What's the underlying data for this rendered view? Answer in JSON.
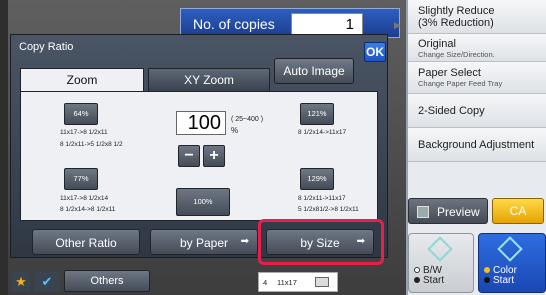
{
  "copies": {
    "label": "No. of copies",
    "value": "1"
  },
  "right_panel": {
    "items": [
      {
        "title": "Slightly Reduce",
        "title2": "(3% Reduction)",
        "sub": ""
      },
      {
        "title": "Original",
        "sub": "Change Size/Direction."
      },
      {
        "title": "Paper Select",
        "sub": "Change Paper Feed Tray"
      },
      {
        "title": "2-Sided Copy",
        "sub": ""
      },
      {
        "title": "Background Adjustment",
        "sub": ""
      }
    ],
    "preview_label": "Preview",
    "ca_label": "CA",
    "bw_start": [
      "B/W",
      "Start"
    ],
    "color_start": [
      "Color",
      "Start"
    ]
  },
  "dialog": {
    "title": "Copy Ratio",
    "ok_label": "OK",
    "tabs": [
      {
        "label": "Zoom",
        "active": true
      },
      {
        "label": "XY Zoom",
        "active": false
      }
    ],
    "auto_image_label": "Auto Image",
    "ratio": {
      "value": "100",
      "range": "( 25~400 )",
      "unit": "%"
    },
    "presets": [
      {
        "label": "64%",
        "notes": [
          "11x17->8 1/2x11",
          "8 1/2x11->5 1/2x8 1/2"
        ]
      },
      {
        "label": "121%",
        "notes": [
          "8 1/2x14->11x17"
        ]
      },
      {
        "label": "77%",
        "notes": [
          "11x17->8 1/2x14",
          "8 1/2x14->8 1/2x11"
        ]
      },
      {
        "label": "100%",
        "notes": []
      },
      {
        "label": "129%",
        "notes": [
          "8 1/2x11->11x17",
          "5 1/2x81/2->8 1/2x11"
        ]
      }
    ],
    "stepper": {
      "minus": "−",
      "plus": "+"
    },
    "bottom_buttons": [
      {
        "label": "Other Ratio"
      },
      {
        "label": "by Paper"
      },
      {
        "label": "by Size",
        "highlighted": true
      }
    ]
  },
  "bottom_bar": {
    "others_label": "Others",
    "paper_indicator": {
      "number": "4",
      "size": "11x17"
    }
  },
  "colors": {
    "accent_blue": "#2c5fc0",
    "highlight_red": "#e5214a",
    "ca_yellow": "#f5c21c",
    "color_start_blue": "#2f6de0"
  }
}
